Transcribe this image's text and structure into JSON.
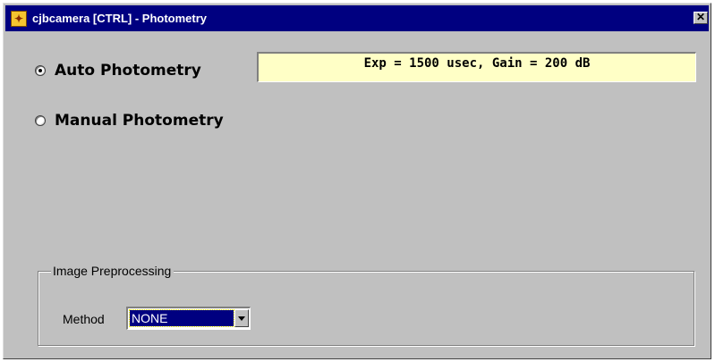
{
  "window": {
    "title": "cjbcamera [CTRL] - Photometry",
    "app_icon": "running-man-icon",
    "close_glyph": "✕"
  },
  "photometry": {
    "auto_label": "Auto Photometry",
    "manual_label": "Manual Photometry",
    "selected": "auto",
    "status_text": "Exp = 1500 usec, Gain = 200 dB"
  },
  "preprocessing": {
    "group_label": "Image Preprocessing",
    "method_label": "Method",
    "method_value": "NONE"
  },
  "colors": {
    "titlebar": "#000080",
    "face": "#c0c0c0",
    "status_bg": "#ffffc6",
    "selection": "#000080"
  }
}
